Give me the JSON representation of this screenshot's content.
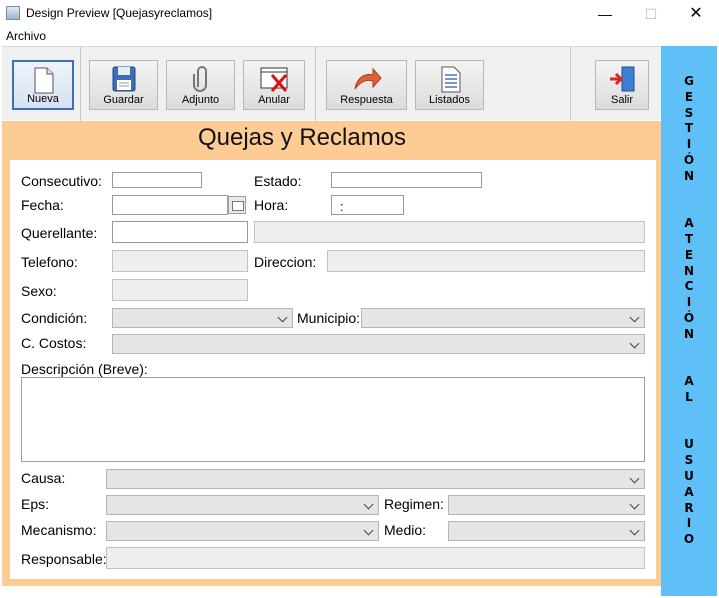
{
  "window": {
    "title": "Design Preview [Quejasyreclamos]",
    "minimize": "—",
    "maximize": "☐",
    "close": "✕"
  },
  "menu": {
    "archivo": "Archivo"
  },
  "toolbar": {
    "nueva": "Nueva",
    "guardar": "Guardar",
    "adjunto": "Adjunto",
    "anular": "Anular",
    "respuesta": "Respuesta",
    "listados": "Listados",
    "salir": "Salir"
  },
  "side_banner": "G\nE\nS\nT\nI\nÓ\nN\n\n\nA\nT\nE\nN\nC\nI\nÓ\nN\n\n\nA\nL\n\n\nU\nS\nU\nA\nR\nI\nO",
  "form": {
    "heading": "Quejas y Reclamos",
    "labels": {
      "consecutivo": "Consecutivo:",
      "estado": "Estado:",
      "fecha": "Fecha:",
      "hora": "Hora:",
      "querellante": "Querellante:",
      "telefono": "Telefono:",
      "direccion": "Direccion:",
      "sexo": "Sexo:",
      "condicion": "Condición:",
      "municipio": "Municipio:",
      "costos": "C. Costos:",
      "descripcion": "Descripción (Breve):",
      "causa": "Causa:",
      "eps": "Eps:",
      "regimen": "Regimen:",
      "mecanismo": "Mecanismo:",
      "medio": "Medio:",
      "responsable": "Responsable:"
    },
    "values": {
      "hora": ":"
    }
  },
  "colors": {
    "form_background": "#fccc94",
    "side_panel": "#5fc0f8",
    "active_button_border": "#3c6fb5"
  }
}
